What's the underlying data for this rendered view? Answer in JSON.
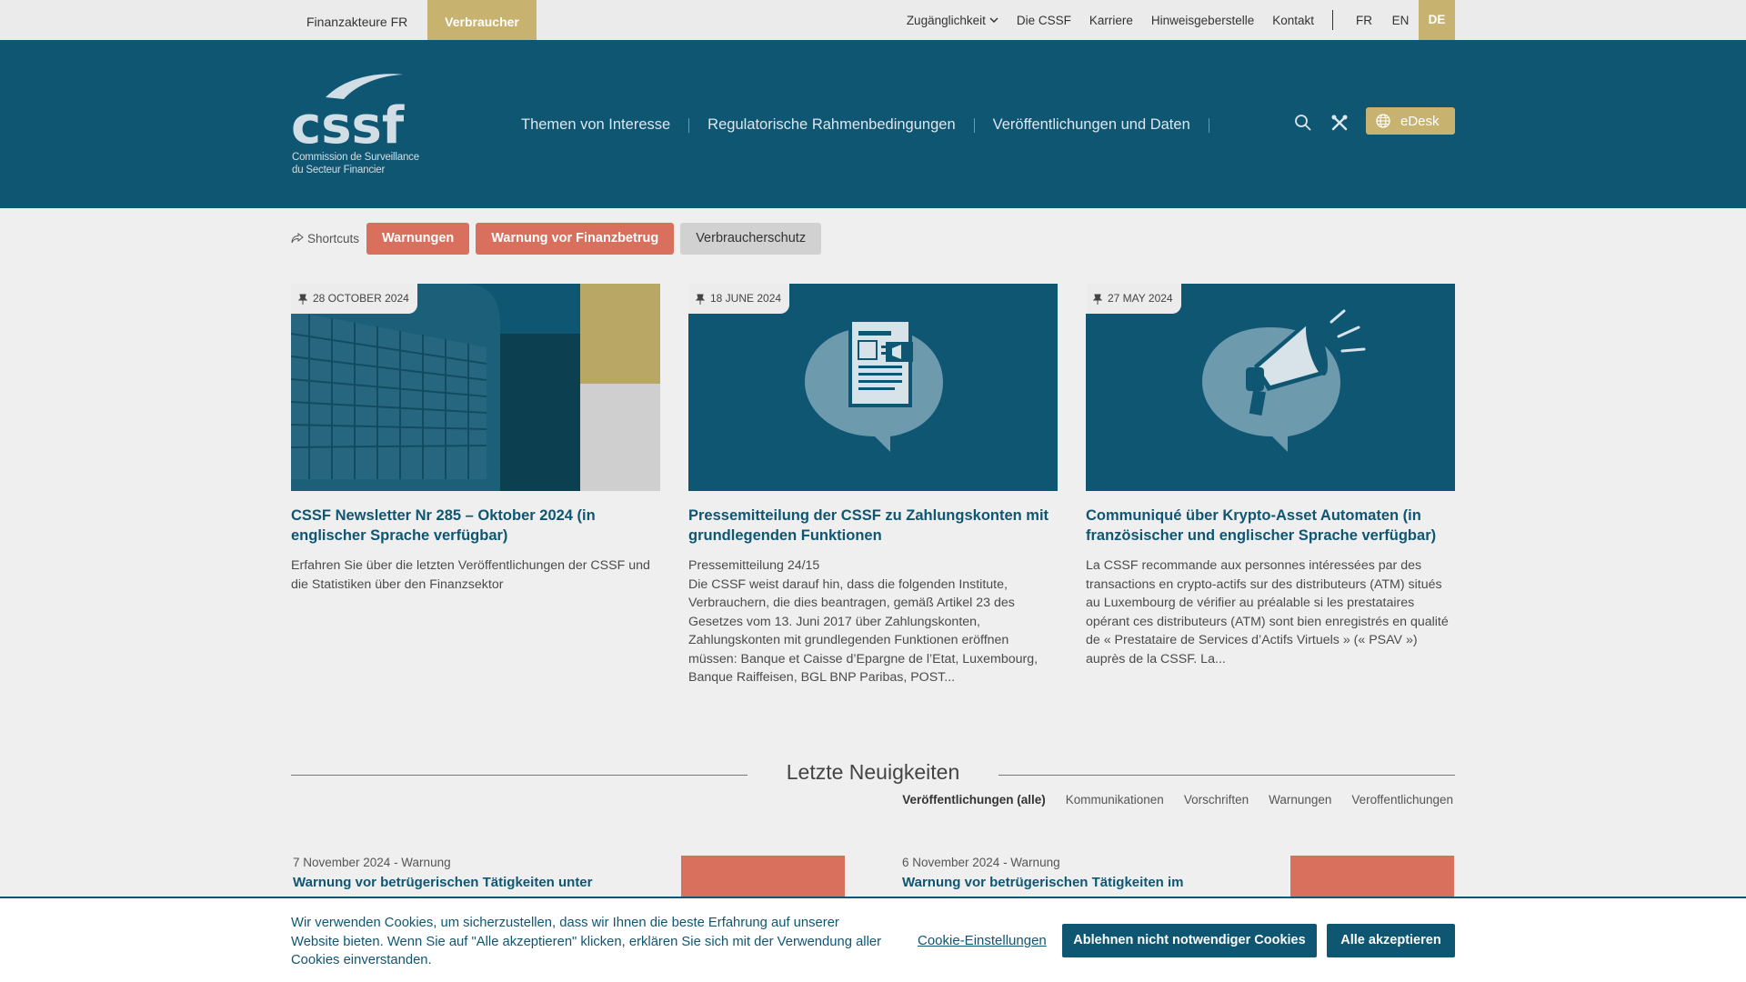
{
  "topbar": {
    "audiences": [
      "Finanzakteure FR",
      "Verbraucher"
    ],
    "links": [
      "Zugänglichkeit",
      "Die CSSF",
      "Karriere",
      "Hinweisgeberstelle",
      "Kontakt"
    ],
    "languages": [
      "FR",
      "EN",
      "DE"
    ],
    "active_language": "DE"
  },
  "header": {
    "logo_text": "cssf",
    "logo_sub_1": "Commission de Surveillance",
    "logo_sub_2": "du Secteur Financier",
    "nav": [
      "Themen von Interesse",
      "Regulatorische Rahmenbedingungen",
      "Veröffentlichungen und Daten"
    ],
    "edesk_label": "eDesk"
  },
  "shortcuts": {
    "label": "Shortcuts",
    "items": [
      "Warnungen",
      "Warnung vor Finanzbetrug",
      "Verbraucherschutz"
    ]
  },
  "cards": [
    {
      "date": "28 OCTOBER 2024",
      "title": "CSSF Newsletter Nr 285 – Oktober 2024 (in englischer Sprache verfügbar)",
      "text": "Erfahren Sie über die letzten Veröffentlichungen der CSSF und die Statistiken über den Finanzsektor"
    },
    {
      "date": "18 JUNE 2024",
      "title": "Pressemitteilung der CSSF zu Zahlungskonten mit grundlegenden Funktionen",
      "text": "Pressemitteilung 24/15\nDie CSSF weist darauf hin, dass die folgenden Institute, Verbrauchern, die dies beantragen, gemäß Artikel 23 des Gesetzes vom 13. Juni 2017 über Zahlungskonten, Zahlungskonten mit grundlegenden Funktionen eröffnen müssen: Banque et Caisse d’Epargne de l’Etat, Luxembourg, Banque Raiffeisen, BGL BNP Paribas, POST..."
    },
    {
      "date": "27 MAY 2024",
      "title": "Communiqué über Krypto-Asset Automaten (in französischer und englischer Sprache verfügbar)",
      "text": "La CSSF recommande aux personnes intéressées par des transactions en crypto-actifs sur des distributeurs (ATM) situés au Luxembourg de vérifier au préalable si les prestataires opérant ces distributeurs (ATM) sont bien enregistrés en qualité de « Prestataire de Services d’Actifs Virtuels » (« PSAV ») auprès de la CSSF. La..."
    }
  ],
  "latest": {
    "title": "Letzte Neuigkeiten",
    "filters": [
      "Veröffentlichungen (alle)",
      "Kommunikationen",
      "Vorschriften",
      "Warnungen",
      "Veroffentlichungen"
    ],
    "active_filter": "Veröffentlichungen (alle)",
    "items": [
      {
        "meta": "7 November 2024 - Warnung",
        "title": "Warnung vor betrügerischen Tätigkeiten unter"
      },
      {
        "meta": "6 November 2024 - Warnung",
        "title": "Warnung vor betrügerischen Tätigkeiten im"
      }
    ]
  },
  "cookie": {
    "message": "Wir verwenden Cookies, um sicherzustellen, dass wir Ihnen die beste Erfahrung auf unserer Website bieten. Wenn Sie auf \"Alle akzeptieren\" klicken, erklären Sie sich mit der Verwendung aller Cookies einverstanden.",
    "settings_label": "Cookie-Einstellungen",
    "reject_label": "Ablehnen nicht notwendiger Cookies",
    "accept_label": "Alle akzeptieren"
  },
  "colors": {
    "primary": "#0f5673",
    "gold": "#c7b26f",
    "warning": "#d9705e"
  },
  "icons": [
    "chevron-down-icon",
    "search-icon",
    "tools-icon",
    "globe-icon",
    "share-icon",
    "pin-icon"
  ]
}
